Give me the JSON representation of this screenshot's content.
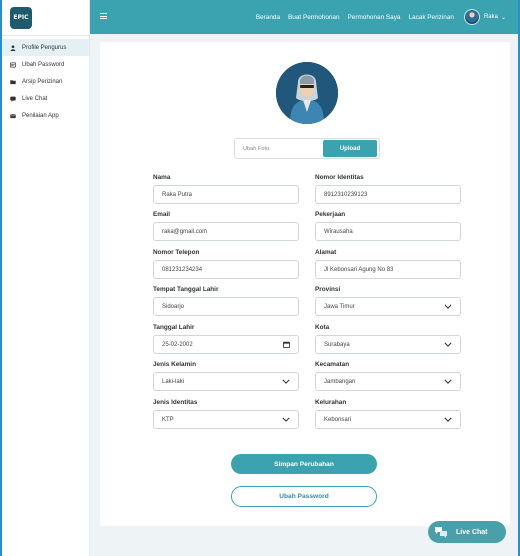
{
  "logo": {
    "text": "EPIC"
  },
  "sidebar": {
    "items": [
      {
        "label": "Profile Pengurus",
        "icon": "user-icon",
        "active": true
      },
      {
        "label": "Ubah Password",
        "icon": "key-card-icon",
        "active": false
      },
      {
        "label": "Arsip Perizinan",
        "icon": "folder-icon",
        "active": false
      },
      {
        "label": "Live Chat",
        "icon": "chat-icon",
        "active": false
      },
      {
        "label": "Penilaian App",
        "icon": "envelope-icon",
        "active": false
      }
    ]
  },
  "topnav": {
    "links": [
      "Beranda",
      "Buat Permohonan",
      "Permohonan Saya",
      "Lacak Perizinan"
    ],
    "user_name": "Raka"
  },
  "profile": {
    "upload_placeholder": "Ubah Foto",
    "upload_label": "Upload",
    "fields": {
      "nama": {
        "label": "Nama",
        "value": "Raka Putra"
      },
      "nomor_identitas": {
        "label": "Nomor Identitas",
        "value": "8912310239123"
      },
      "email": {
        "label": "Email",
        "value": "raka@gmail.com"
      },
      "pekerjaan": {
        "label": "Pekerjaan",
        "value": "Wirausaha"
      },
      "telepon": {
        "label": "Nomor Telepon",
        "value": "081231234234"
      },
      "alamat": {
        "label": "Alamat",
        "value": "Jl Kebonsari Agung No 83"
      },
      "ttl": {
        "label": "Tempat Tanggal Lahir",
        "value": "Sidoarjo"
      },
      "provinsi": {
        "label": "Provinsi",
        "value": "Jawa Timur"
      },
      "tanggal_lahir": {
        "label": "Tanggal Lahir",
        "value": "25-02-2002"
      },
      "kota": {
        "label": "Kota",
        "value": "Surabaya"
      },
      "jenis_kelamin": {
        "label": "Jenis Kelamin",
        "value": "Laki-laki"
      },
      "kecamatan": {
        "label": "Kecamatan",
        "value": "Jambangan"
      },
      "jenis_identitas": {
        "label": "Jenis Identitas",
        "value": "KTP"
      },
      "kelurahan": {
        "label": "Kelurahan",
        "value": "Kebonsari"
      }
    },
    "save_label": "Simpan Perubahan",
    "change_password_label": "Ubah Password"
  },
  "chat_button": {
    "label": "Live Chat"
  },
  "colors": {
    "accent": "#3ba2b0",
    "sidebar_active": "#e4f0f4",
    "frame": "#2a8fc2"
  }
}
